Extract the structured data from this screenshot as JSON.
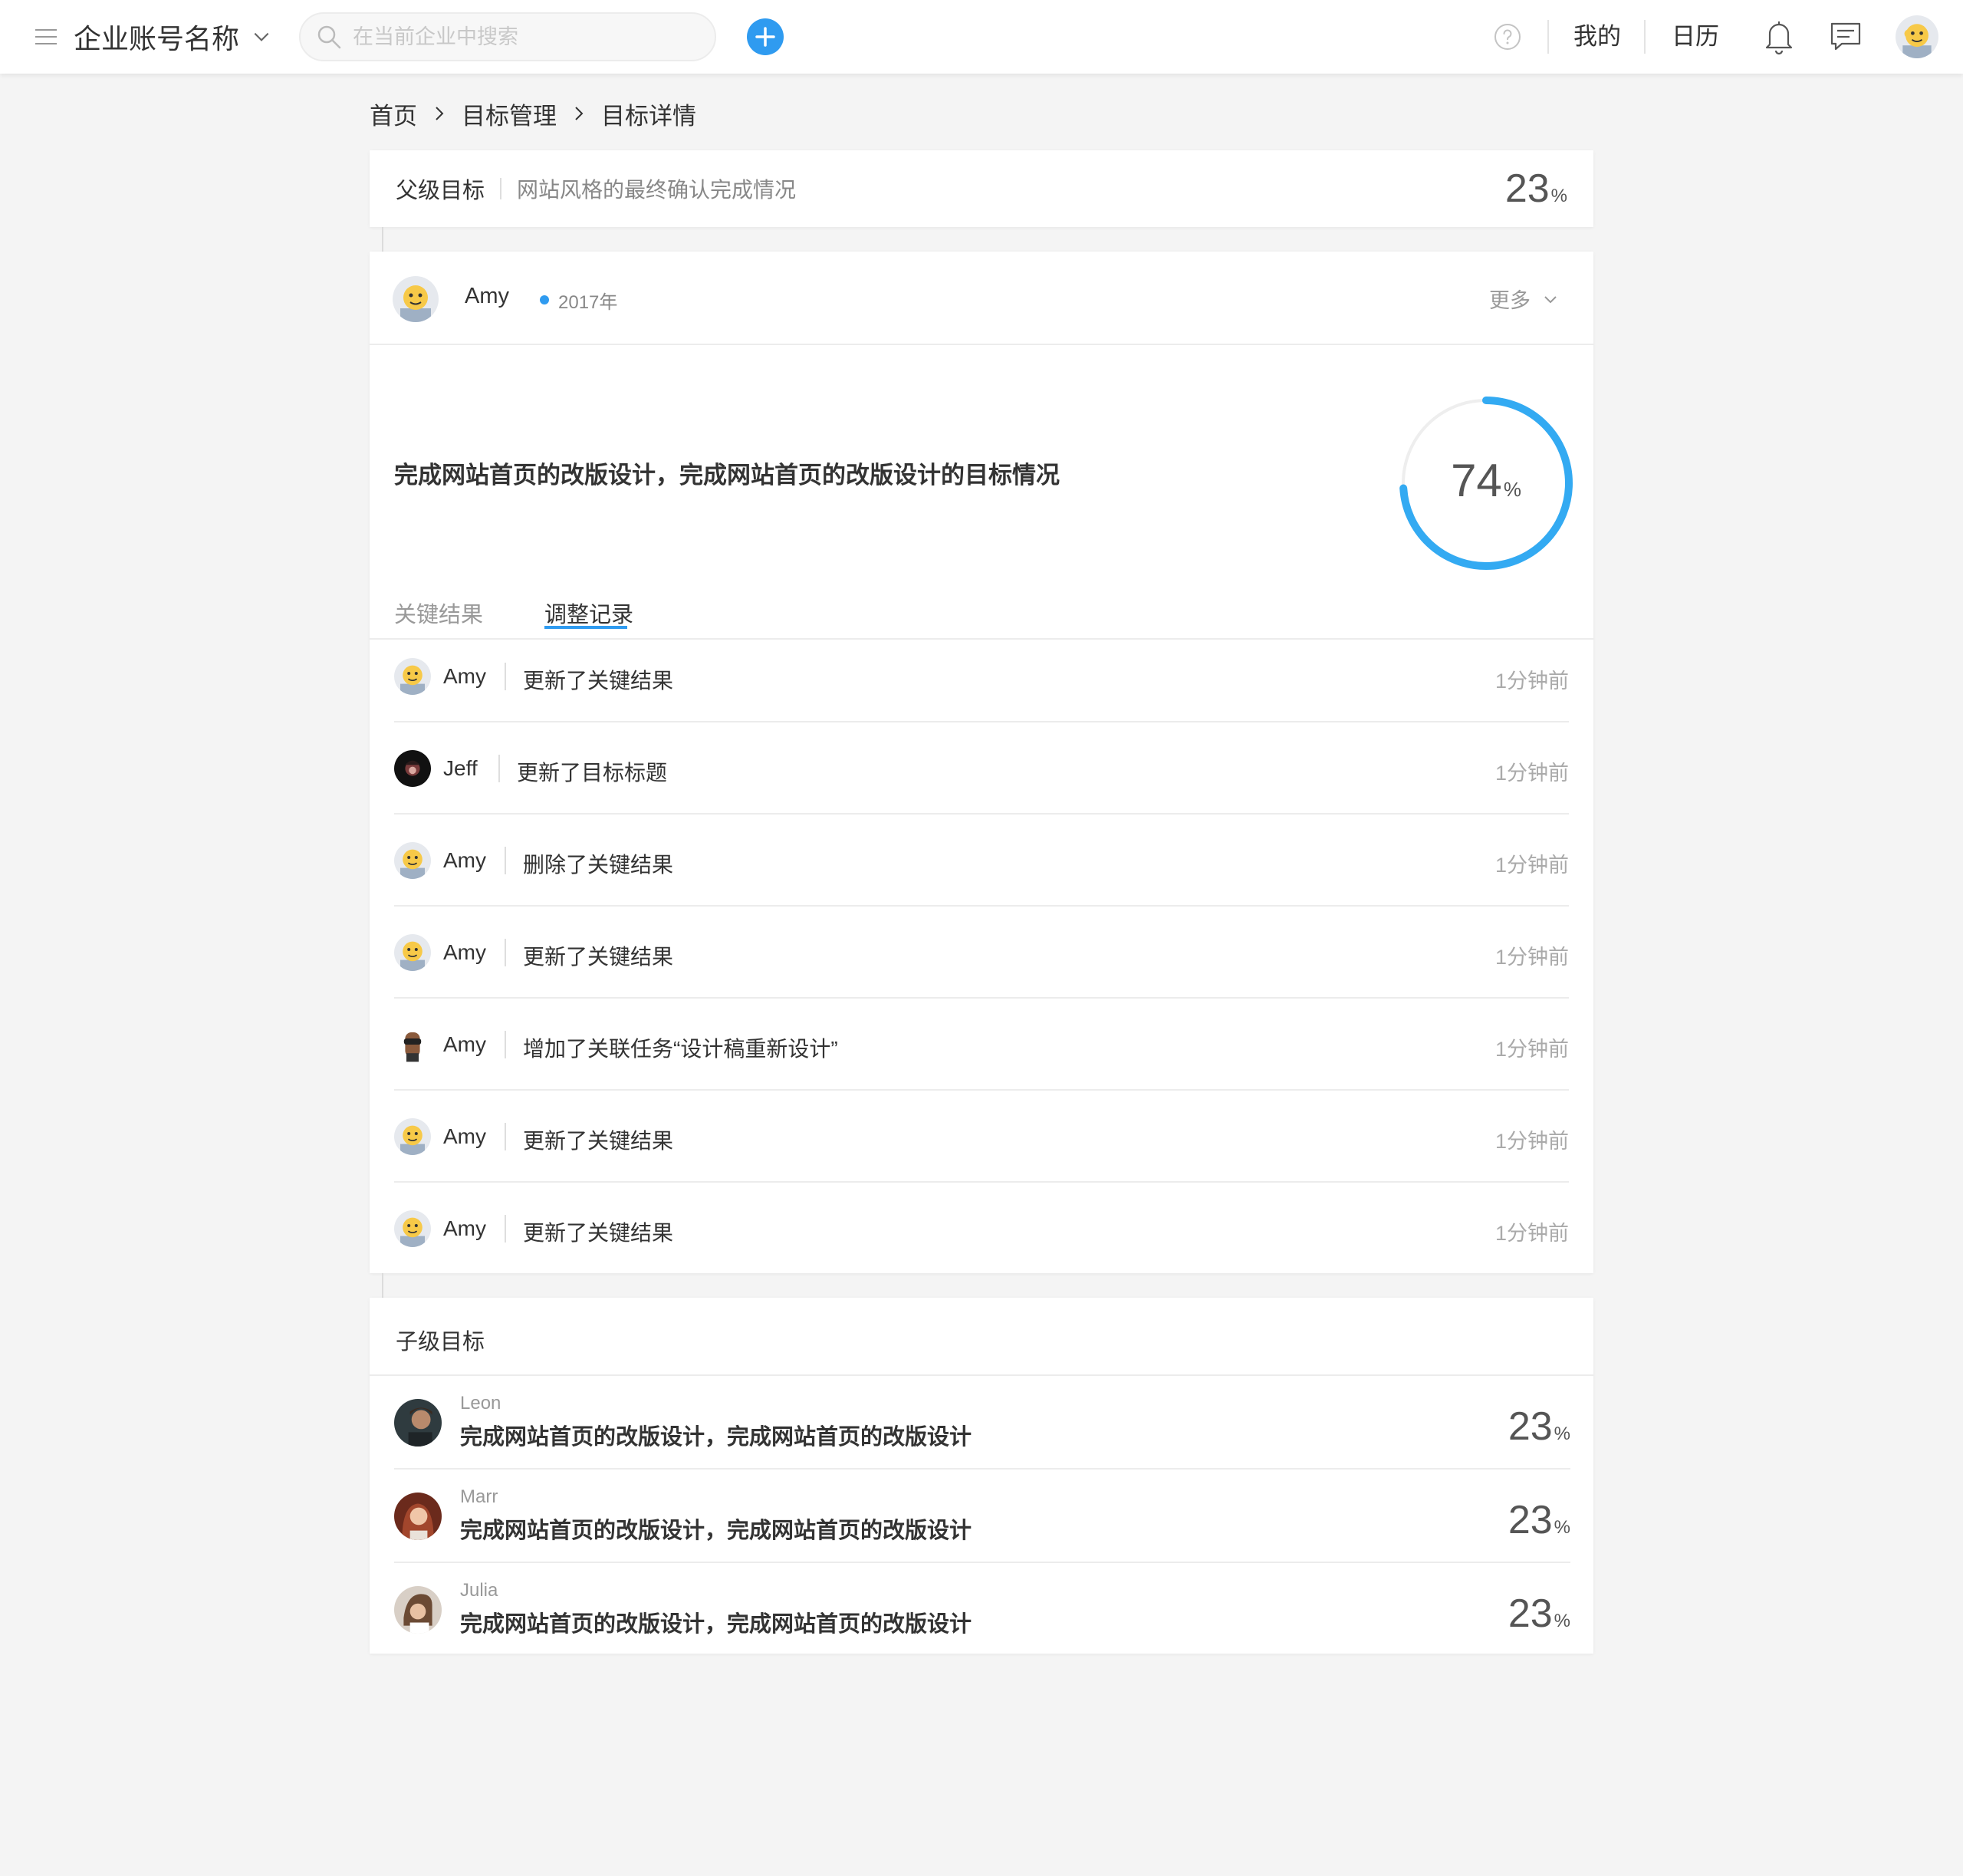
{
  "topbar": {
    "company_name": "企业账号名称",
    "search_placeholder": "在当前企业中搜索",
    "nav_mine": "我的",
    "nav_calendar": "日历"
  },
  "breadcrumb": [
    "首页",
    "目标管理",
    "目标详情"
  ],
  "parent_goal": {
    "label": "父级目标",
    "title": "网站风格的最终确认完成情况",
    "percent": "23",
    "unit": "%"
  },
  "goal": {
    "owner": "Amy",
    "year": "2017年",
    "more_label": "更多",
    "title": "完成网站首页的改版设计，完成网站首页的改版设计的目标情况",
    "progress": 0.74,
    "percent": "74",
    "unit": "%",
    "tabs": [
      {
        "label": "关键结果",
        "active": false
      },
      {
        "label": "调整记录",
        "active": true
      }
    ]
  },
  "log": [
    {
      "user": "Amy",
      "action": "更新了关键结果",
      "time": "1分钟前",
      "avatar": "emoji"
    },
    {
      "user": "Jeff",
      "action": "更新了目标标题",
      "time": "1分钟前",
      "avatar": "dark"
    },
    {
      "user": "Amy",
      "action": "删除了关键结果",
      "time": "1分钟前",
      "avatar": "emoji"
    },
    {
      "user": "Amy",
      "action": "更新了关键结果",
      "time": "1分钟前",
      "avatar": "emoji"
    },
    {
      "user": "Amy",
      "action": "增加了关联任务“设计稿重新设计”",
      "time": "1分钟前",
      "avatar": "goggles"
    },
    {
      "user": "Amy",
      "action": "更新了关键结果",
      "time": "1分钟前",
      "avatar": "emoji"
    },
    {
      "user": "Amy",
      "action": "更新了关键结果",
      "time": "1分钟前",
      "avatar": "emoji"
    }
  ],
  "child_goals": {
    "label": "子级目标",
    "items": [
      {
        "name": "Leon",
        "title": "完成网站首页的改版设计，完成网站首页的改版设计",
        "percent": "23",
        "unit": "%",
        "avatar": "photo-dark"
      },
      {
        "name": "Marr",
        "title": "完成网站首页的改版设计，完成网站首页的改版设计",
        "percent": "23",
        "unit": "%",
        "avatar": "photo-red"
      },
      {
        "name": "Julia",
        "title": "完成网站首页的改版设计，完成网站首页的改版设计",
        "percent": "23",
        "unit": "%",
        "avatar": "photo-light"
      }
    ]
  },
  "colors": {
    "accent": "#2f9bf0",
    "ring_track": "#eeeeee",
    "background": "#f4f4f4"
  }
}
